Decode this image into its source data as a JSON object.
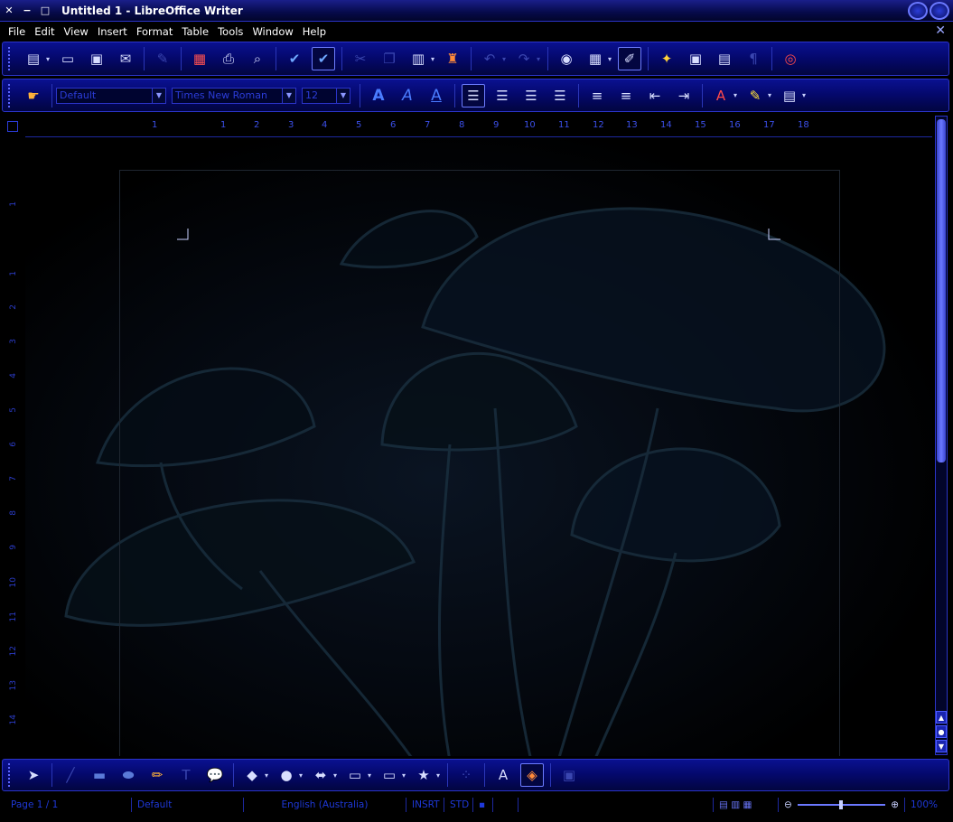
{
  "window": {
    "title": "Untitled 1 - LibreOffice Writer",
    "close_glyph": "✕",
    "minimize_glyph": "−",
    "maximize_glyph": "□"
  },
  "menu": {
    "items": [
      "File",
      "Edit",
      "View",
      "Insert",
      "Format",
      "Table",
      "Tools",
      "Window",
      "Help"
    ],
    "close_glyph": "✕"
  },
  "standard_toolbar": {
    "icons": [
      "new-document-icon",
      "open-icon",
      "save-icon",
      "email-icon",
      "edit-file-icon",
      "export-pdf-icon",
      "print-icon",
      "print-preview-icon",
      "spellcheck-icon",
      "auto-spellcheck-icon",
      "cut-icon",
      "copy-icon",
      "paste-icon",
      "clone-format-icon",
      "undo-icon",
      "redo-icon",
      "navigator-icon",
      "table-icon",
      "draw-functions-icon",
      "gallery-icon",
      "data-sources-icon",
      "nonprinting-characters-icon",
      "help-icon"
    ]
  },
  "formatting_toolbar": {
    "paragraph_style": "Default",
    "font_name": "Times New Roman",
    "font_size": "12"
  },
  "ruler": {
    "h_numbers": [
      "1",
      "1",
      "2",
      "3",
      "4",
      "5",
      "6",
      "7",
      "8",
      "9",
      "10",
      "11",
      "12",
      "13",
      "14",
      "15",
      "16",
      "17",
      "18"
    ],
    "v_numbers": [
      "1",
      "1",
      "2",
      "3",
      "4",
      "5",
      "6",
      "7",
      "8",
      "9",
      "10",
      "11",
      "12",
      "13",
      "14"
    ]
  },
  "statusbar": {
    "page": "Page 1 / 1",
    "style": "Default",
    "language": "English (Australia)",
    "insert_mode": "INSRT",
    "selection_mode": "STD",
    "zoom": "100%"
  },
  "colors": {
    "accent": "#2b34c8",
    "toolbar_bg": "#04086a",
    "status_text": "#1e38d8"
  }
}
